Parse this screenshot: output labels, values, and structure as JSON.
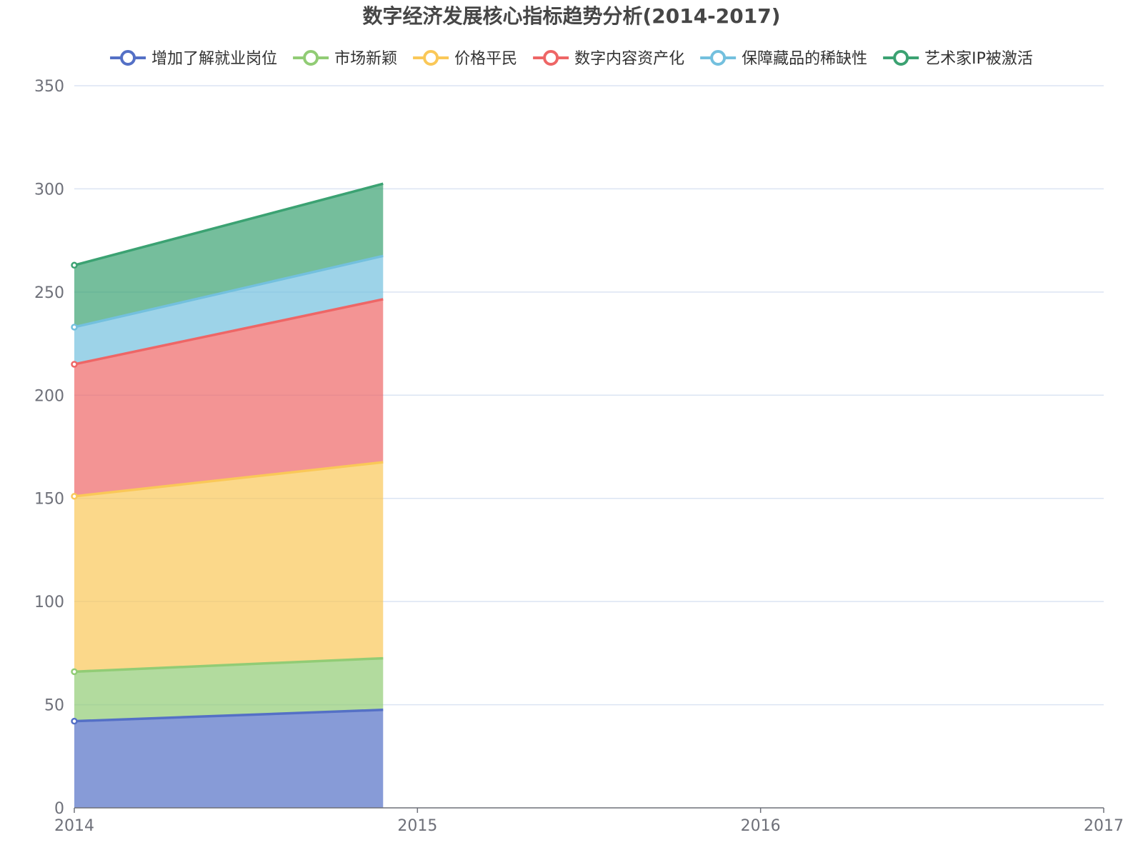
{
  "chart_data": {
    "type": "area",
    "stacked": true,
    "title": "数字经济发展核心指标趋势分析(2014-2017)",
    "x": [
      2014,
      2015,
      2016,
      2017
    ],
    "x_tick_labels": [
      "2014",
      "2015",
      "2016",
      "2017"
    ],
    "data_x_end": 2014.9,
    "ylim": [
      0,
      350
    ],
    "y_ticks": [
      0,
      50,
      100,
      150,
      200,
      250,
      300,
      350
    ],
    "grid": true,
    "legend_position": "top-center",
    "series": [
      {
        "name": "增加了解就业岗位",
        "color": "#5470c6",
        "values": [
          42,
          47.5
        ]
      },
      {
        "name": "市场新颖",
        "color": "#91cc75",
        "values": [
          24,
          25
        ]
      },
      {
        "name": "价格平民",
        "color": "#fac858",
        "values": [
          85,
          95
        ]
      },
      {
        "name": "数字内容资产化",
        "color": "#ee6666",
        "values": [
          64,
          79
        ]
      },
      {
        "name": "保障藏品的稀缺性",
        "color": "#73c0de",
        "values": [
          18,
          21
        ]
      },
      {
        "name": "艺术家IP被激活",
        "color": "#3ba272",
        "values": [
          30,
          35
        ]
      }
    ]
  }
}
